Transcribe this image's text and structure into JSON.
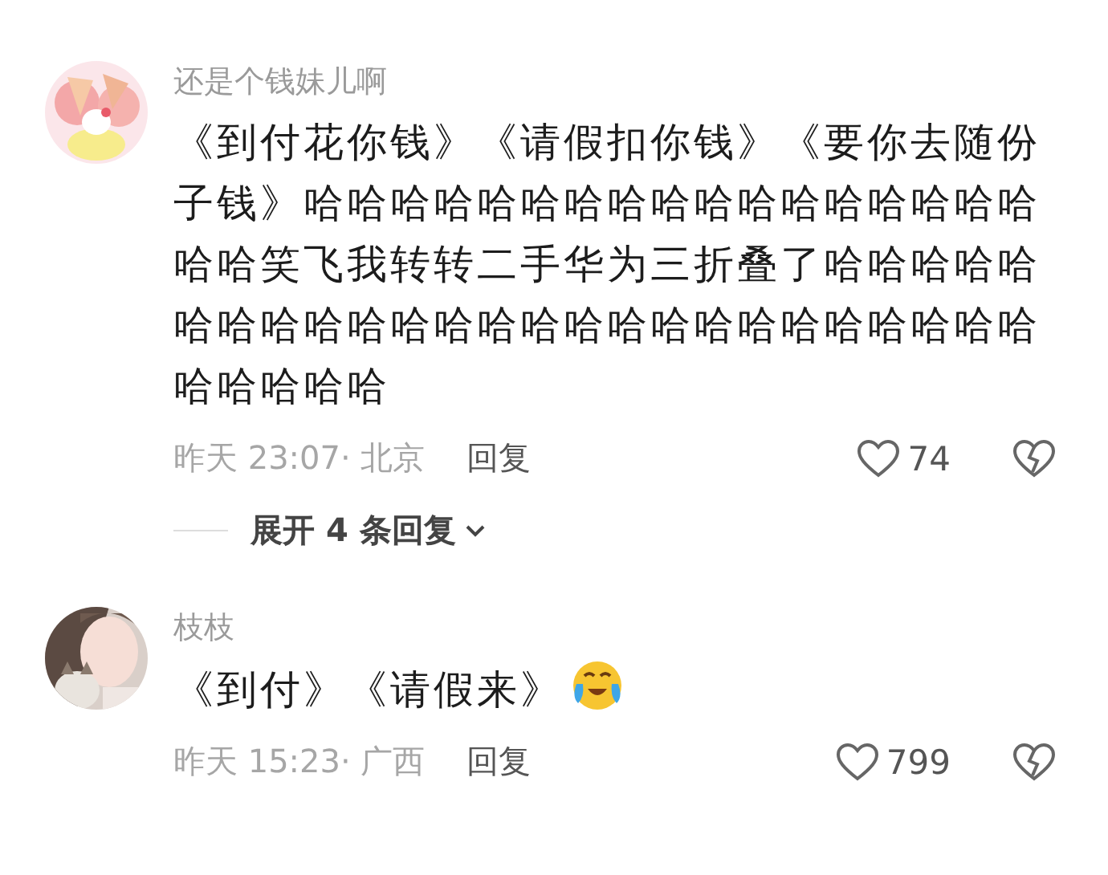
{
  "comments": [
    {
      "author": "还是个钱妹儿啊",
      "text": "《到付花你钱》《请假扣你钱》《要你去随份子钱》哈哈哈哈哈哈哈哈哈哈哈哈哈哈哈哈哈哈哈笑飞我转转二手华为三折叠了哈哈哈哈哈哈哈哈哈哈哈哈哈哈哈哈哈哈哈哈哈哈哈哈哈哈哈哈哈哈",
      "has_emoji": false,
      "meta": "昨天 23:07· 北京",
      "reply": "回复",
      "likes": "74",
      "expand": "展开 4 条回复"
    },
    {
      "author": "枝枝",
      "text": "《到付》《请假来》",
      "has_emoji": true,
      "meta": "昨天 15:23· 广西",
      "reply": "回复",
      "likes": "799"
    }
  ]
}
